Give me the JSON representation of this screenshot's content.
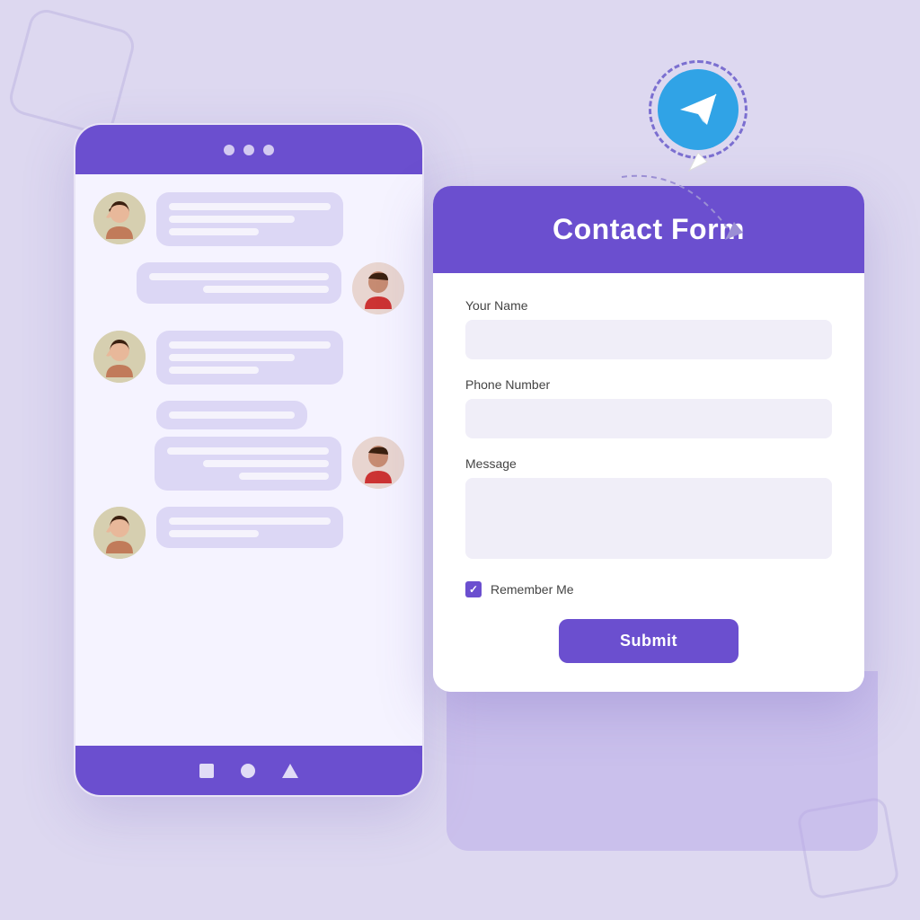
{
  "background": {
    "color": "#ddd8f0"
  },
  "phone": {
    "header_dots": 3,
    "footer_icons": [
      "square",
      "circle",
      "triangle"
    ]
  },
  "telegram": {
    "icon_label": "paper-plane"
  },
  "contact_form": {
    "title": "Contact Form",
    "fields": [
      {
        "label": "Your Name",
        "type": "text",
        "placeholder": ""
      },
      {
        "label": "Phone Number",
        "type": "tel",
        "placeholder": ""
      },
      {
        "label": "Message",
        "type": "textarea",
        "placeholder": ""
      }
    ],
    "remember_me": {
      "label": "Remember Me",
      "checked": true
    },
    "submit_label": "Submit"
  }
}
